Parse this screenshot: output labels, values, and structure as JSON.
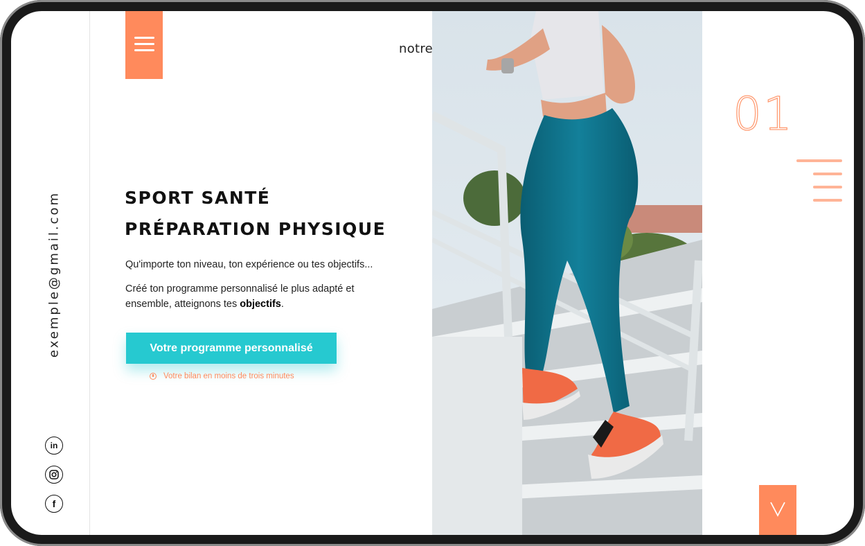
{
  "brand": "notrenom",
  "email": "exemple@gmail.com",
  "hero": {
    "title_line1": "SPORT SANTÉ",
    "title_line2": "PRÉPARATION PHYSIQUE",
    "paragraph1": "Qu'importe ton niveau, ton expérience ou tes objectifs...",
    "paragraph2_start": "Créé ton programme personnalisé le plus adapté et ensemble, atteignons tes ",
    "paragraph2_bold": "objectifs",
    "paragraph2_end": ".",
    "cta_label": "Votre programme personnalisé",
    "cta_note": "Votre bilan en moins de trois minutes"
  },
  "slide_number": "01",
  "social": {
    "linkedin_label": "in",
    "instagram_icon": "instagram-icon",
    "facebook_label": "f"
  },
  "colors": {
    "accent": "#ff8a5c",
    "cta": "#26c9d0",
    "leggings": "#0d6f86"
  }
}
